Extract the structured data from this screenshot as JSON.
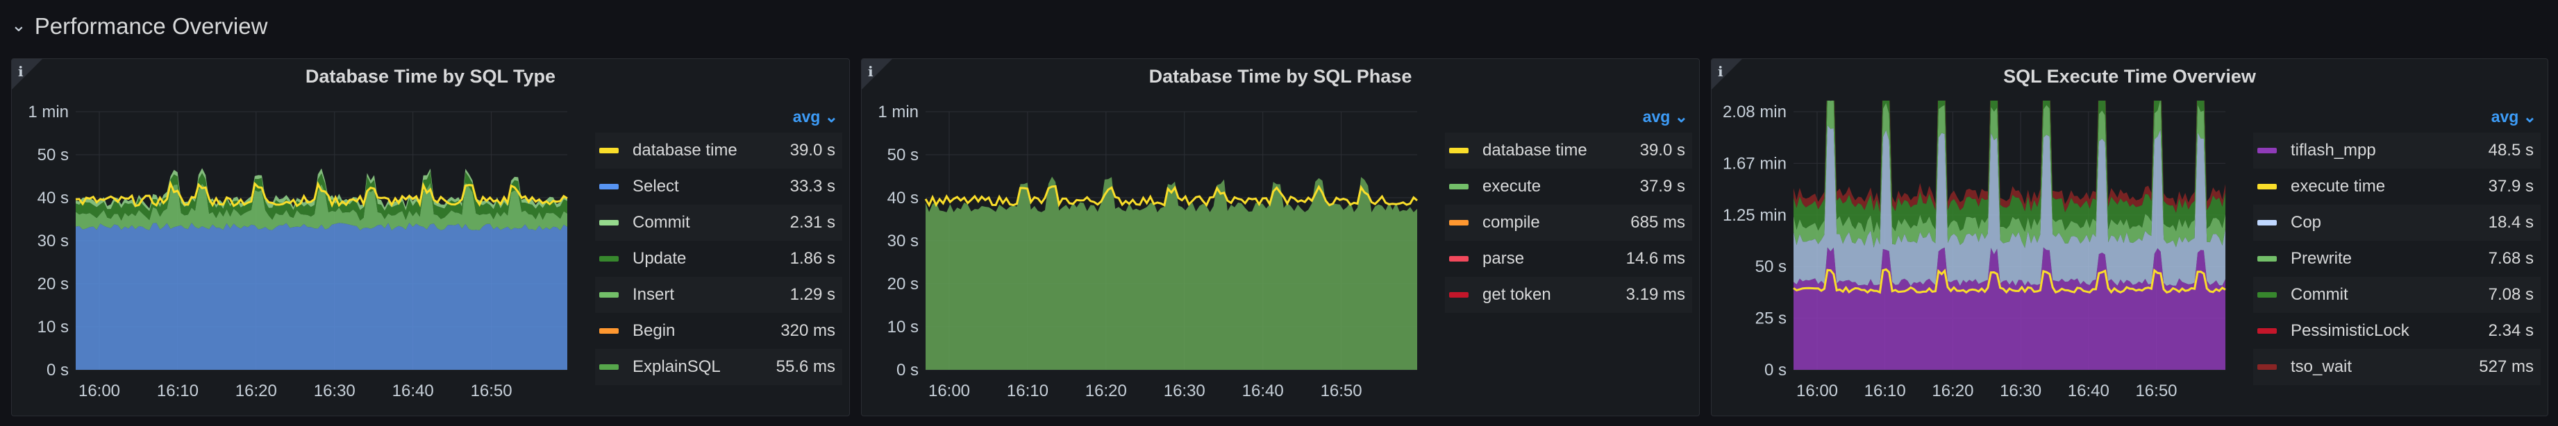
{
  "row": {
    "title": "Performance Overview"
  },
  "panels": [
    {
      "title": "Database Time by SQL Type",
      "info": "i",
      "legend_agg": "avg ⌄",
      "y_ticks": [
        "1 min",
        "50 s",
        "40 s",
        "30 s",
        "20 s",
        "10 s",
        "0 s"
      ],
      "x_ticks": [
        "16:00",
        "16:10",
        "16:20",
        "16:30",
        "16:40",
        "16:50"
      ],
      "legend": [
        {
          "name": "database time",
          "value": "39.0 s",
          "color": "#fade2a"
        },
        {
          "name": "Select",
          "value": "33.3 s",
          "color": "#5794f2"
        },
        {
          "name": "Commit",
          "value": "2.31 s",
          "color": "#96d98d"
        },
        {
          "name": "Update",
          "value": "1.86 s",
          "color": "#37872d"
        },
        {
          "name": "Insert",
          "value": "1.29 s",
          "color": "#73bf69"
        },
        {
          "name": "Begin",
          "value": "320 ms",
          "color": "#ff9830"
        },
        {
          "name": "ExplainSQL",
          "value": "55.6 ms",
          "color": "#56a64b"
        }
      ]
    },
    {
      "title": "Database Time by SQL Phase",
      "info": "i",
      "legend_agg": "avg ⌄",
      "y_ticks": [
        "1 min",
        "50 s",
        "40 s",
        "30 s",
        "20 s",
        "10 s",
        "0 s"
      ],
      "x_ticks": [
        "16:00",
        "16:10",
        "16:20",
        "16:30",
        "16:40",
        "16:50"
      ],
      "legend": [
        {
          "name": "database time",
          "value": "39.0 s",
          "color": "#fade2a"
        },
        {
          "name": "execute",
          "value": "37.9 s",
          "color": "#73bf69"
        },
        {
          "name": "compile",
          "value": "685 ms",
          "color": "#ff9830"
        },
        {
          "name": "parse",
          "value": "14.6 ms",
          "color": "#f2495c"
        },
        {
          "name": "get token",
          "value": "3.19 ms",
          "color": "#c4162a"
        }
      ]
    },
    {
      "title": "SQL Execute Time Overview",
      "info": "i",
      "legend_agg": "avg ⌄",
      "y_ticks": [
        "2.08 min",
        "1.67 min",
        "1.25 min",
        "50 s",
        "25 s",
        "0 s"
      ],
      "x_ticks": [
        "16:00",
        "16:10",
        "16:20",
        "16:30",
        "16:40",
        "16:50"
      ],
      "legend": [
        {
          "name": "tiflash_mpp",
          "value": "48.5 s",
          "color": "#8f3bb8"
        },
        {
          "name": "execute time",
          "value": "37.9 s",
          "color": "#fade2a"
        },
        {
          "name": "Cop",
          "value": "18.4 s",
          "color": "#c0d8ff"
        },
        {
          "name": "Prewrite",
          "value": "7.68 s",
          "color": "#73bf69"
        },
        {
          "name": "Commit",
          "value": "7.08 s",
          "color": "#37872d"
        },
        {
          "name": "PessimisticLock",
          "value": "2.34 s",
          "color": "#c4162a"
        },
        {
          "name": "tso_wait",
          "value": "527 ms",
          "color": "#8a2525"
        }
      ]
    }
  ]
}
